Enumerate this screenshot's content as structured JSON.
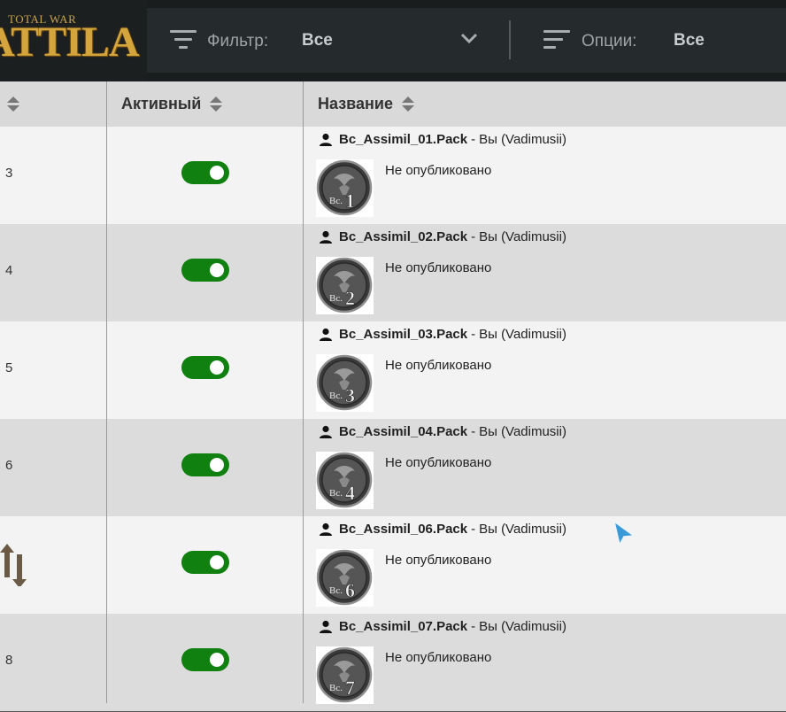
{
  "header": {
    "logo_top": "TOTAL WAR",
    "logo_main": "ATTILA",
    "filter_label": "Фильтр:",
    "filter_value": "Все",
    "options_label": "Опции:",
    "options_value": "Все",
    "filter_icon": "filter-lines-icon",
    "options_icon": "sort-lines-icon"
  },
  "columns": {
    "active": "Активный",
    "name": "Название"
  },
  "colors": {
    "toggle_on": "#108010",
    "topbar": "#1a1d1e",
    "row_light": "#f3f3f3",
    "row_dark": "#dcdcdc"
  },
  "rows": [
    {
      "order": "3",
      "active": true,
      "name": "Bc_Assimil_01.Pack",
      "separator": "-",
      "author": "Вы (Vadimusii)",
      "status": "Не опубликовано",
      "badge": "1"
    },
    {
      "order": "4",
      "active": true,
      "name": "Bc_Assimil_02.Pack",
      "separator": "-",
      "author": "Вы (Vadimusii)",
      "status": "Не опубликовано",
      "badge": "2"
    },
    {
      "order": "5",
      "active": true,
      "name": "Bc_Assimil_03.Pack",
      "separator": "-",
      "author": "Вы (Vadimusii)",
      "status": "Не опубликовано",
      "badge": "3"
    },
    {
      "order": "6",
      "active": true,
      "name": "Bc_Assimil_04.Pack",
      "separator": "-",
      "author": "Вы (Vadimusii)",
      "status": "Не опубликовано",
      "badge": "4"
    },
    {
      "order": "",
      "active": true,
      "name": "Bc_Assimil_06.Pack",
      "separator": "-",
      "author": "Вы (Vadimusii)",
      "status": "Не опубликовано",
      "badge": "6"
    },
    {
      "order": "8",
      "active": true,
      "name": "Bc_Assimil_07.Pack",
      "separator": "-",
      "author": "Вы (Vadimusii)",
      "status": "Не опубликовано",
      "badge": "7"
    }
  ],
  "thumb_text": "Bc."
}
